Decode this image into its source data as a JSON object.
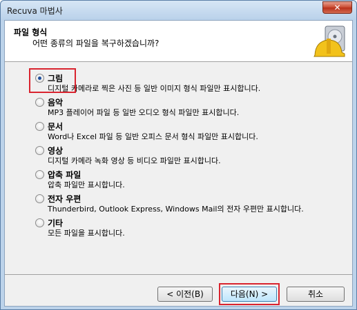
{
  "window": {
    "title": "Recuva 마법사",
    "close_glyph": "✕"
  },
  "header": {
    "title": "파일 형식",
    "subtitle": "어떤 종류의 파일을 복구하겠습니까?",
    "icon": "recuva-helmet-drive-icon"
  },
  "options": [
    {
      "label": "그림",
      "desc": "디지털 카메라로 찍은 사진 등 일반 이미지 형식 파일만 표시합니다.",
      "checked": true
    },
    {
      "label": "음악",
      "desc": "MP3 플레이어 파일 등 일반 오디오 형식 파일만 표시합니다.",
      "checked": false
    },
    {
      "label": "문서",
      "desc": "Word나 Excel 파일 등 일반 오피스 문서 형식 파일만 표시합니다.",
      "checked": false
    },
    {
      "label": "영상",
      "desc": "디지털 카메라 녹화 영상 등 비디오 파일만 표시합니다.",
      "checked": false
    },
    {
      "label": "압축 파일",
      "desc": "압축 파일만 표시합니다.",
      "checked": false
    },
    {
      "label": "전자 우편",
      "desc": "Thunderbird, Outlook Express, Windows Mail의 전자 우편만 표시합니다.",
      "checked": false
    },
    {
      "label": "기타",
      "desc": "모든 파일을 표시합니다.",
      "checked": false
    }
  ],
  "buttons": {
    "back": "< 이전(B)",
    "next": "다음(N) >",
    "cancel": "취소"
  },
  "colors": {
    "annotation_red": "#d9232e",
    "title_bar": "#bcd3ea"
  }
}
